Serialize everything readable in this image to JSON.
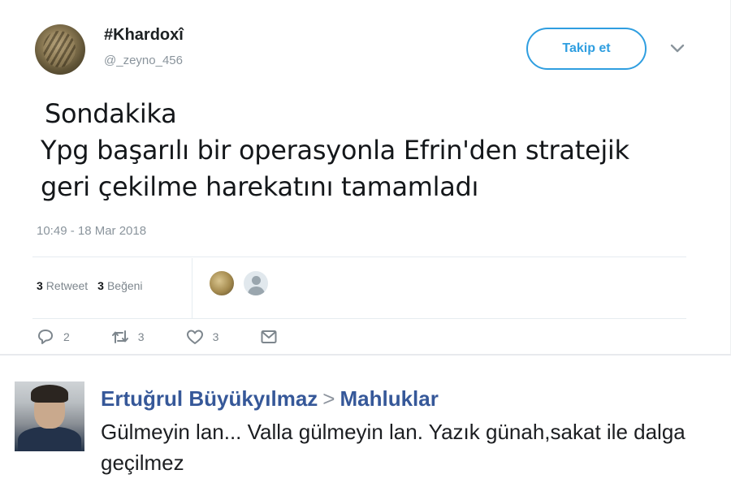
{
  "tweet": {
    "display_name": "#Khardoxî",
    "handle": "@_zeyno_456",
    "follow_label": "Takip et",
    "text_lines": [
      "Sondakika",
      "Ypg başarılı bir operasyonla Efrin'den stratejik",
      "geri çekilme harekatını tamamladı"
    ],
    "timestamp": "10:49 - 18 Mar 2018",
    "stats": {
      "retweet_count": "3",
      "retweet_label": "Retweet",
      "like_count": "3",
      "like_label": "Beğeni"
    },
    "actions": {
      "reply_count": "2",
      "retweet_count": "3",
      "like_count": "3"
    },
    "icons": [
      "reply-icon",
      "retweet-icon",
      "like-icon",
      "message-icon",
      "chevron-down-icon"
    ],
    "colors": {
      "accent": "#2f9ee0",
      "muted": "#8a949c"
    }
  },
  "comment": {
    "author": "Ertuğrul Büyükyılmaz",
    "separator": ">",
    "group": "Mahluklar",
    "text": "Gülmeyin lan... Valla gülmeyin lan. Yazık günah,sakat ile dalga geçilmez",
    "colors": {
      "name": "#365899"
    }
  }
}
